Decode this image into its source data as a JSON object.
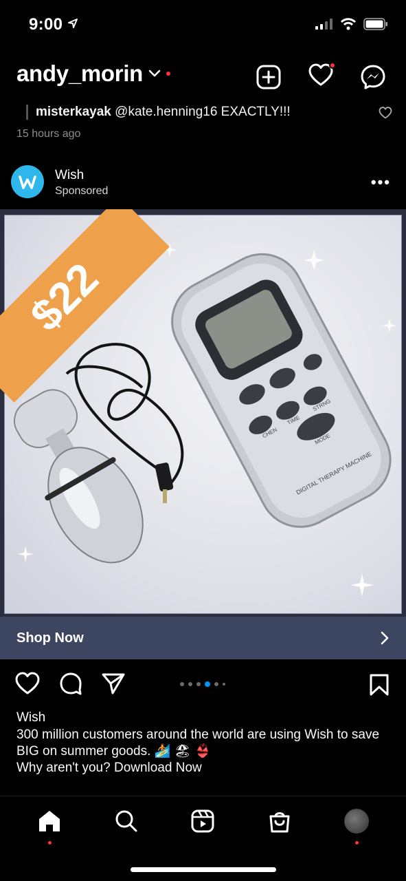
{
  "status_bar": {
    "time": "9:00"
  },
  "header": {
    "username": "andy_morin"
  },
  "comment": {
    "user": "misterkayak",
    "text": "@kate.henning16 EXACTLY!!!",
    "time": "15 hours ago"
  },
  "post": {
    "author": "Wish",
    "sponsored_label": "Sponsored",
    "price_tag": "$22",
    "product_label_lines": [
      "CHEN",
      "TIME",
      "STRNG",
      "MODE",
      "DIGITAL THERAPY MACHINE"
    ],
    "cta_label": "Shop Now",
    "carousel": {
      "count": 6,
      "active_index": 3
    },
    "caption_author": "Wish",
    "caption_text": "300 million customers around the world are using Wish to save BIG on summer goods. 🏄 🏖 👙",
    "caption_text2": "Why aren't you? Download Now"
  },
  "colors": {
    "accent_blue": "#0095f6",
    "notification_red": "#ff3040",
    "wish_blue": "#2fb7ec",
    "price_orange": "#eea04a",
    "cta_bar": "#3c4660"
  },
  "icons": {
    "header": [
      "new-post-icon",
      "heart-icon",
      "messenger-icon"
    ],
    "actions": [
      "like-icon",
      "comment-icon",
      "share-icon",
      "save-icon"
    ],
    "nav": [
      "home-icon",
      "search-icon",
      "reels-icon",
      "shop-icon",
      "profile-avatar"
    ]
  }
}
